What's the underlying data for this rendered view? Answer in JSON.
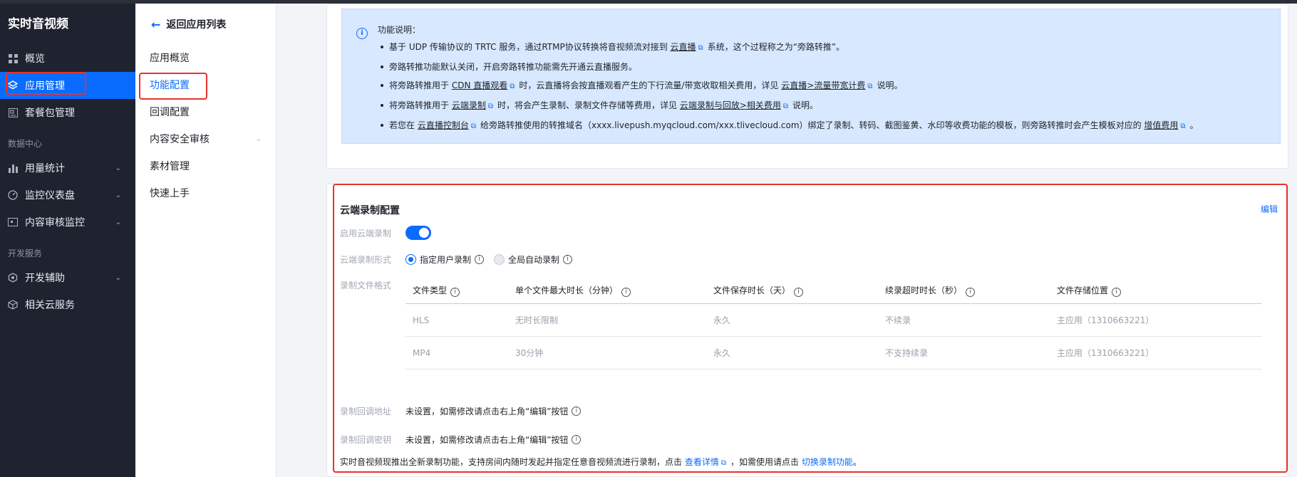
{
  "sidebar": {
    "title": "实时音视频",
    "items": [
      {
        "label": "概览",
        "icon": "grid-icon"
      },
      {
        "label": "应用管理",
        "icon": "layers-icon"
      },
      {
        "label": "套餐包管理",
        "icon": "package-icon"
      }
    ],
    "group1": "数据中心",
    "items2": [
      {
        "label": "用量统计",
        "icon": "bar-chart-icon"
      },
      {
        "label": "监控仪表盘",
        "icon": "gauge-icon"
      },
      {
        "label": "内容审核监控",
        "icon": "monitor-icon"
      }
    ],
    "group2": "开发服务",
    "items3": [
      {
        "label": "开发辅助",
        "icon": "hexagon-icon"
      },
      {
        "label": "相关云服务",
        "icon": "cube-icon"
      }
    ]
  },
  "subnav": {
    "back": "返回应用列表",
    "items": [
      "应用概览",
      "功能配置",
      "回调配置",
      "内容安全审核",
      "素材管理",
      "快速上手"
    ]
  },
  "notice": {
    "title": "功能说明：",
    "l1": {
      "a": "基于 UDP 传输协议的 TRTC 服务，通过RTMP协议转换将音视频流对接到 ",
      "link": "云直播",
      "b": "系统，这个过程称之为“旁路转推”。"
    },
    "l2": "旁路转推功能默认关闭，开启旁路转推功能需先开通云直播服务。",
    "l3": {
      "a": "将旁路转推用于 ",
      "link": "CDN 直播观看",
      "b": "时，云直播将会按直播观看产生的下行流量/带宽收取相关费用，详见 ",
      "link2": "云直播>流量带宽计费",
      "c": "说明。"
    },
    "l4": {
      "a": "将旁路转推用于 ",
      "link": "云端录制",
      "b": "时，将会产生录制、录制文件存储等费用，详见 ",
      "link2": "云端录制与回放>相关费用",
      "c": "说明。"
    },
    "l5": {
      "a": "若您在 ",
      "link": "云直播控制台",
      "b": "给旁路转推使用的转推域名（xxxx.livepush.myqcloud.com/xxx.tlivecloud.com）绑定了录制、转码、截图鉴黄、水印等收费功能的模板，则旁路转推时会产生模板对应的 ",
      "link2": "增值费用",
      "c": "。"
    }
  },
  "record": {
    "title": "云端录制配置",
    "edit": "编辑",
    "enable_label": "启用云端录制",
    "enabled": true,
    "mode_label": "云端录制形式",
    "mode_options": [
      "指定用户录制",
      "全局自动录制"
    ],
    "mode_selected": "指定用户录制",
    "format_label": "录制文件格式",
    "columns": [
      "文件类型",
      "单个文件最大时长（分钟）",
      "文件保存时长（天）",
      "续录超时时长（秒）",
      "文件存储位置"
    ],
    "rows": [
      [
        "HLS",
        "无时长限制",
        "永久",
        "不续录",
        "主应用（1310663221）"
      ],
      [
        "MP4",
        "30分钟",
        "永久",
        "不支持续录",
        "主应用（1310663221）"
      ]
    ],
    "callback_url_label": "录制回调地址",
    "callback_url_value": "未设置，如需修改请点击右上角“编辑”按钮",
    "callback_key_label": "录制回调密钥",
    "callback_key_value": "未设置，如需修改请点击右上角“编辑”按钮",
    "footer_a": "实时音视频现推出全新录制功能，支持房间内随时发起并指定任意音视频流进行录制，点击 ",
    "footer_link1": "查看详情",
    "footer_b": "，如需使用请点击 ",
    "footer_link2": "切换录制功能",
    "footer_c": "。"
  },
  "colors": {
    "accent": "#0a6cff",
    "highlight": "#e8322c",
    "sidebar": "#1f2330"
  }
}
